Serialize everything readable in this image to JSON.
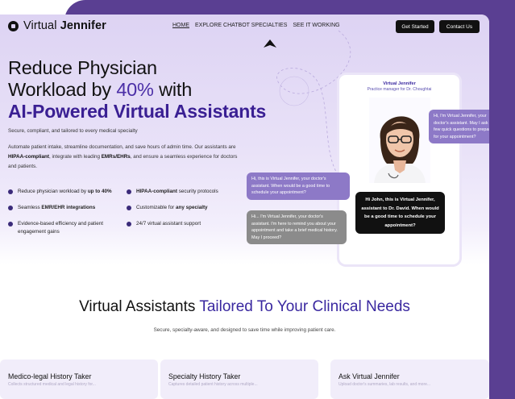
{
  "brand": {
    "name_light": "Virtual",
    "name_bold": "Jennifer"
  },
  "nav": {
    "links": [
      "HOME",
      "EXPLORE CHATBOT SPECIALTIES",
      "SEE IT WORKING"
    ],
    "get_started": "Get Started",
    "contact": "Contact Us"
  },
  "hero": {
    "title_line1": "Reduce Physician",
    "title_line2_pre": "Workload by ",
    "title_line2_accent": "40%",
    "title_line2_post": " with",
    "title_line3": "AI-Powered Virtual Assistants",
    "subtitle": "Secure, compliant, and tailored to every medical specialty",
    "desc_1": "Automate patient intake, streamline documentation, and save hours of admin time. Our assistants are ",
    "desc_b1": "HIPAA-compliant",
    "desc_2": ", integrate with leading ",
    "desc_b2": "EMRs/EHRs",
    "desc_3": ", and ensure a seamless experience for doctors and patients."
  },
  "features": {
    "f1_text": "Reduce physician workload by ",
    "f1_bold": "up to 40%",
    "f2_bold": "HIPAA-compliant",
    "f2_text": " security protocols",
    "f3_text": "Seamless ",
    "f3_bold": "EMR/EHR integrations",
    "f4_text": "Customizable for ",
    "f4_bold": "any specialty",
    "f5_text": "Evidence-based efficiency and patient engagement gains",
    "f6_text": "24/7 virtual assistant support"
  },
  "chat": {
    "header_title": "Virtual Jennifer",
    "header_subtitle": "Practice manager for Dr. Choughtai",
    "bubble_top_right": "Hi, I'm Virtual Jennifer, your doctor's assistant. May I ask a few quick questions to prepare for your appointment?",
    "bubble_left_1": "Hi, this is Virtual Jennifer, your doctor's assistant. When would be a good time to schedule your appointment?",
    "bubble_left_2": "Hi... I'm Virtual Jennifer, your doctor's assistant. I'm here to remind you about your appointment and take a brief medical history. May I proceed?",
    "bubble_black": "Hi John, this is Virtual Jennifer, assistant to Dr. David. When would be a good time to schedule your appointment?"
  },
  "section": {
    "title_plain": "Virtual Assistants ",
    "title_accent": "Tailored To Your Clinical Needs",
    "subtitle": "Secure, specialty-aware, and designed to save time while improving patient care."
  },
  "cards": [
    {
      "title": "Medico-legal History Taker",
      "fade": "Collects structured medical and legal history for..."
    },
    {
      "title": "Specialty History Taker",
      "fade": "Captures detailed patient history across multiple..."
    },
    {
      "title": "Ask Virtual Jennifer",
      "fade": "Upload doctor's summaries, lab results, and more..."
    }
  ],
  "colors": {
    "accent": "#4b2fa7",
    "frame": "#5a3f92",
    "hero_bg": "#ddd3f3"
  },
  "icons": {
    "logo": "logo-mark-icon",
    "cursor": "cursor-arrow-icon",
    "bullet": "dot-icon",
    "avatar": "doctor-avatar-icon"
  }
}
